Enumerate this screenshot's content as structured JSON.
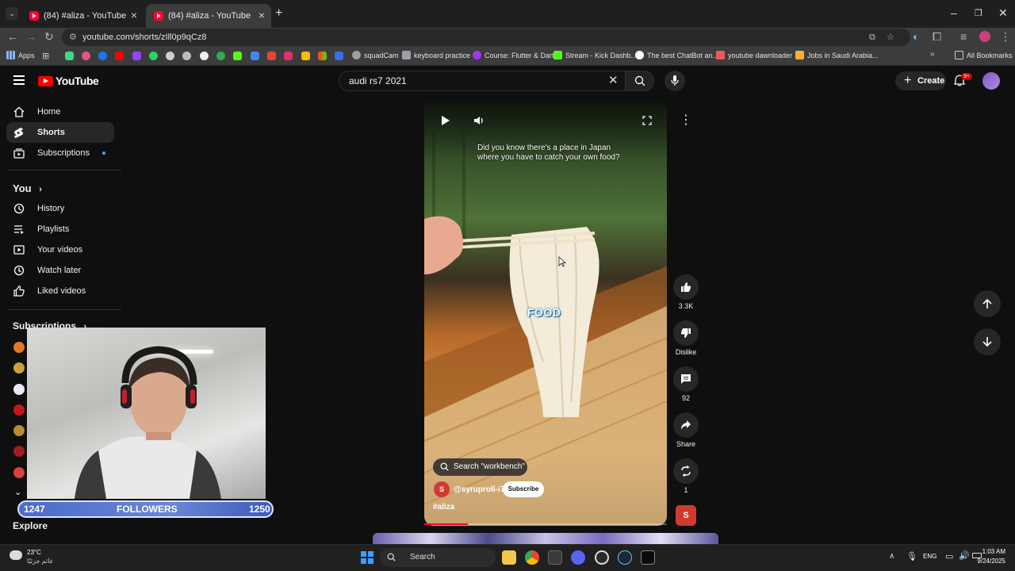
{
  "browser": {
    "tabs": [
      {
        "title": "(84) #aliza - YouTube",
        "active": false
      },
      {
        "title": "(84) #aliza - YouTube",
        "active": true
      }
    ],
    "url": "youtube.com/shorts/zIll0p9qCz8",
    "bookmarks": [
      {
        "label": "Apps",
        "color": "#6aa3ff"
      },
      {
        "label": "squadCam",
        "color": "#9aa0a6"
      },
      {
        "label": "keyboard practice",
        "color": "#9aa0a6"
      },
      {
        "label": "Course: Flutter & Dart",
        "color": "#a435f0"
      },
      {
        "label": "Stream - Kick Dashb...",
        "color": "#53fc18"
      },
      {
        "label": "The best ChatBot an...",
        "color": "#ffffff"
      },
      {
        "label": "youtube dawnloader",
        "color": "#e85c5c"
      },
      {
        "label": "Jobs in Saudi Arabia...",
        "color": "#f2b233"
      }
    ],
    "all_bookmarks": "All Bookmarks"
  },
  "youtube": {
    "logo": "YouTube",
    "search_query": "audi rs7 2021",
    "create_label": "Create",
    "notif_count": "9+"
  },
  "sidebar": {
    "items": [
      {
        "label": "Home",
        "icon": "home-icon"
      },
      {
        "label": "Shorts",
        "icon": "shorts-icon"
      },
      {
        "label": "Subscriptions",
        "icon": "subscriptions-icon"
      }
    ],
    "you_label": "You",
    "you_items": [
      {
        "label": "History",
        "icon": "history-icon"
      },
      {
        "label": "Playlists",
        "icon": "playlists-icon"
      },
      {
        "label": "Your videos",
        "icon": "your-videos-icon"
      },
      {
        "label": "Watch later",
        "icon": "watch-later-icon"
      },
      {
        "label": "Liked videos",
        "icon": "liked-videos-icon"
      }
    ],
    "subscriptions_label": "Subscriptions",
    "explore_label": "Explore"
  },
  "stream_overlay": {
    "followers_current": "1247",
    "followers_label": "FOLLOWERS",
    "followers_goal": "1250"
  },
  "short": {
    "caption_line1": "Did you know there's a place in Japan",
    "caption_line2": "where you have to catch your own food?",
    "overlay_word": "FOOD",
    "search_suggestion": "Search \"workbench\"",
    "channel_initial": "S",
    "channel_name": "@syruproll-i7",
    "subscribe_label": "Subscribe",
    "hashtag": "#aliza",
    "progress": 0.18
  },
  "actions": {
    "likes": "3.3K",
    "dislike_label": "Dislike",
    "comments": "92",
    "share_label": "Share",
    "remix_count": "1",
    "channel_initial": "S"
  },
  "taskbar": {
    "weather_temp": "23°C",
    "weather_desc": "غائم جزئيًا",
    "search_label": "Search",
    "language": "ENG",
    "time": "1:03 AM",
    "date": "9/24/2025"
  }
}
